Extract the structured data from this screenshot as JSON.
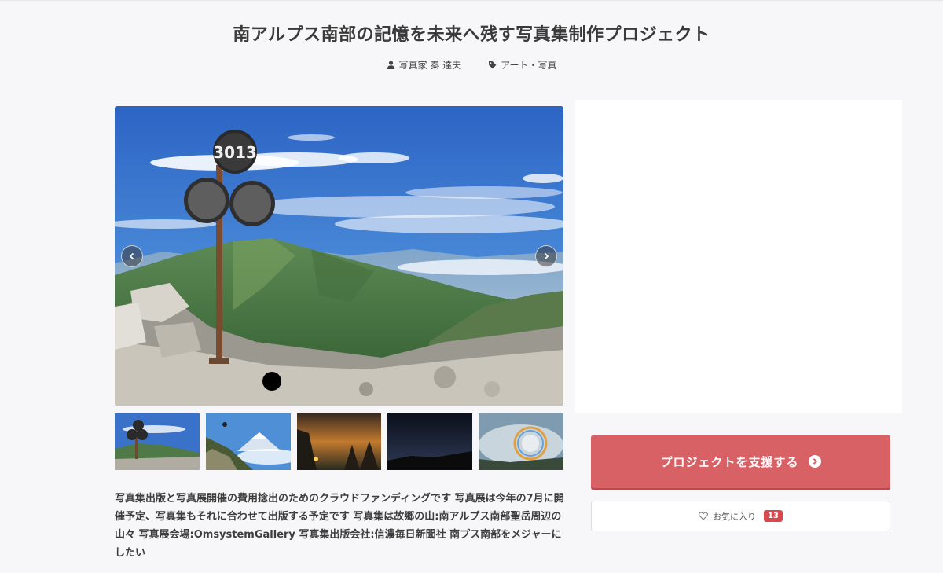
{
  "project": {
    "title": "南アルプス南部の記憶を未来へ残す写真集制作プロジェクト",
    "author": "写真家 秦 達夫",
    "category": "アート・写真",
    "description": "写真集出版と写真展開催の費用捻出のためのクラウドファンディングです 写真展は今年の7月に開催予定、写真集もそれに合わせて出版する予定です 写真集は故郷の山:南アルプス南部聖岳周辺の山々 写真展会場:OmsystemGallery 写真集出版会社:信濃毎日新聞社 南プス南部をメジャーにしたい"
  },
  "icons": {
    "author": "person-icon",
    "category": "tag-icon",
    "prev": "chevron-left-icon",
    "next": "chevron-right-icon",
    "support": "arrow-right-circle-icon",
    "favorite": "heart-icon"
  },
  "gallery": {
    "summit_sign_text": "3013",
    "thumbnails": [
      {
        "name": "summit-sign"
      },
      {
        "name": "fuji-with-bird"
      },
      {
        "name": "sunset-trees"
      },
      {
        "name": "night-ridge"
      },
      {
        "name": "brocken-halo"
      }
    ]
  },
  "actions": {
    "support_label": "プロジェクトを支援する",
    "favorite_label": "お気に入り",
    "favorite_count": "13"
  },
  "colors": {
    "support_button": "#d86166",
    "favorite_badge": "#d9484e",
    "background": "#f7f7f9"
  }
}
